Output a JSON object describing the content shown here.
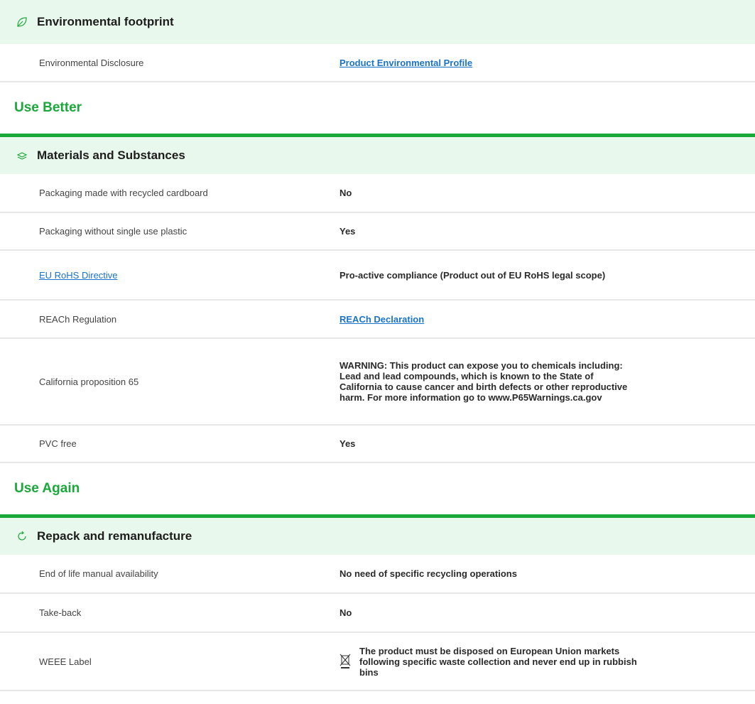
{
  "make_better": {
    "header": {
      "title": "Environmental footprint",
      "icon": "leaf-icon"
    },
    "rows": [
      {
        "label": "Environmental Disclosure",
        "value": "Product Environmental Profile",
        "value_is_link": true
      }
    ]
  },
  "use_better": {
    "group_title": "Use Better",
    "header": {
      "title": "Materials and Substances",
      "icon": "layers-icon"
    },
    "rows": [
      {
        "label": "Packaging made with recycled cardboard",
        "value": "No"
      },
      {
        "label": "Packaging without single use plastic",
        "value": "Yes"
      },
      {
        "label": "EU RoHS Directive",
        "value": "Pro-active compliance (Product out of EU RoHS legal scope)",
        "label_is_link": true
      },
      {
        "label": "REACh Regulation",
        "value": "REACh Declaration",
        "value_is_link": true
      },
      {
        "label": "California proposition 65",
        "value": "WARNING: This product can expose you to chemicals including: Lead and lead compounds, which is known to the State of California to cause cancer and birth defects or other reproductive harm. For more information go to www.P65Warnings.ca.gov"
      },
      {
        "label": "PVC free",
        "value": "Yes"
      }
    ]
  },
  "use_again": {
    "group_title": "Use Again",
    "header": {
      "title": "Repack and remanufacture",
      "icon": "refresh-icon"
    },
    "rows": [
      {
        "label": "End of life manual availability",
        "value": "No need of specific recycling operations"
      },
      {
        "label": "Take-back",
        "value": "No"
      },
      {
        "label": "WEEE Label",
        "value": "The product must be disposed on European Union markets following specific waste collection and never end up in rubbish bins",
        "icon": "weee-bin-icon"
      }
    ]
  },
  "colors": {
    "accent": "#1aa83a",
    "header_bg": "#e9f8ec",
    "link": "#1a73c6",
    "divider": "#e6e6e6"
  }
}
